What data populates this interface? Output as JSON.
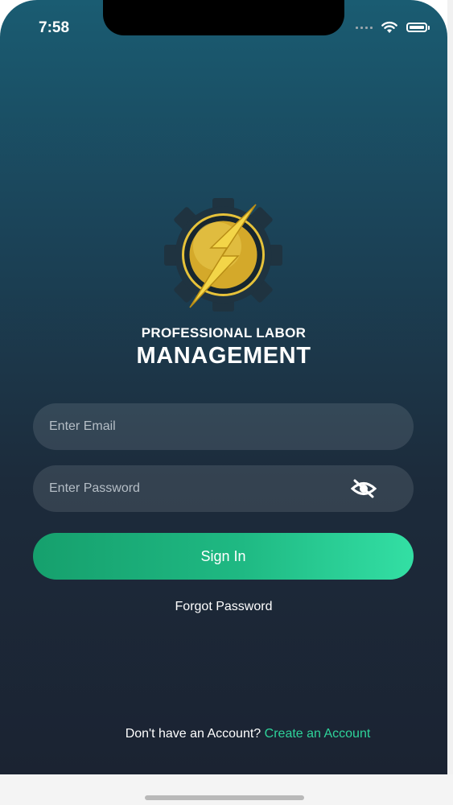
{
  "status_bar": {
    "time": "7:58",
    "icons": [
      "cellular-signal-icon",
      "wifi-icon",
      "battery-icon"
    ]
  },
  "brand": {
    "logo_icon": "gear-lightning-logo",
    "line1": "PROFESSIONAL LABOR",
    "line2": "MANAGEMENT"
  },
  "form": {
    "email_placeholder": "Enter Email",
    "email_value": "",
    "password_placeholder": "Enter Password",
    "password_value": "",
    "password_toggle_icon": "eye-slash-icon",
    "signin_label": "Sign In",
    "forgot_label": "Forgot Password"
  },
  "footer": {
    "prompt": "Don't have an Account?",
    "link": "Create an Account"
  },
  "colors": {
    "gradient_top": "#1a5c72",
    "gradient_bottom": "#1b2332",
    "accent_green": "#1fb983",
    "link_green": "#2ed39a",
    "logo_gold": "#e6c23a"
  }
}
